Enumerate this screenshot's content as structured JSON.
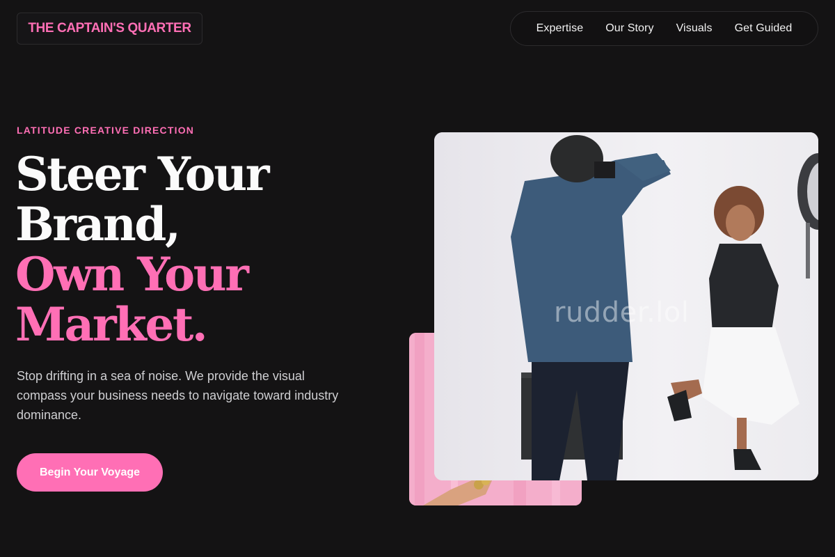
{
  "header": {
    "brand": "THE CAPTAIN'S QUARTER",
    "nav": [
      {
        "label": "Expertise"
      },
      {
        "label": "Our Story"
      },
      {
        "label": "Visuals"
      },
      {
        "label": "Get Guided"
      }
    ]
  },
  "hero": {
    "eyebrow": "LATITUDE CREATIVE DIRECTION",
    "headline_lines": [
      "Steer Your",
      "Brand,",
      "Own Your",
      "Market."
    ],
    "lede": "Stop drifting in a sea of noise. We provide the visual compass your business needs to navigate toward industry dominance.",
    "cta_label": "Begin Your Voyage"
  },
  "media": {
    "watermark": "rudder.lol"
  },
  "colors": {
    "background": "#141314",
    "accent": "#ff6fb5",
    "text": "#fbfbfb",
    "muted": "#cfcfd2"
  }
}
